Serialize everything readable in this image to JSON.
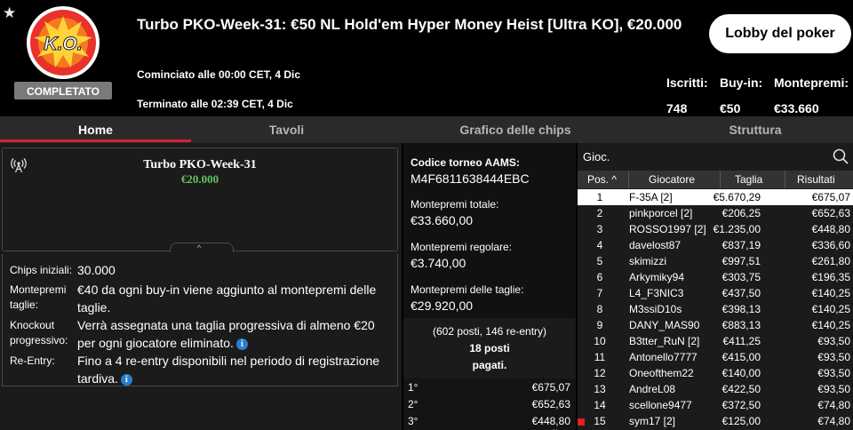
{
  "header": {
    "title": "Turbo PKO-Week-31: €50 NL Hold'em Hyper Money Heist [Ultra KO], €20.000",
    "badge_logo_text": "K.O.",
    "badge_status": "COMPLETATO",
    "started": "Cominciato alle 00:00 CET, 4 Dic",
    "ended": "Terminato alle 02:39 CET, 4 Dic",
    "lobby_button": "Lobby del poker",
    "stats": [
      {
        "label": "Iscritti:",
        "value": "748"
      },
      {
        "label": "Buy-in:",
        "value": "€50"
      },
      {
        "label": "Montepremi:",
        "value": "€33.660"
      }
    ]
  },
  "tabs": [
    {
      "label": "Home",
      "active": true
    },
    {
      "label": "Tavoli",
      "active": false
    },
    {
      "label": "Grafico delle chips",
      "active": false
    },
    {
      "label": "Struttura",
      "active": false
    }
  ],
  "widget": {
    "title": "Turbo PKO-Week-31",
    "amount": "€20.000",
    "collapse_glyph": "^"
  },
  "info": [
    {
      "label": "Chips iniziali:",
      "value": "30.000",
      "info_icon": false
    },
    {
      "label": "Montepremi taglie:",
      "value": "€40 da ogni buy-in viene aggiunto al montepremi delle taglie.",
      "info_icon": false
    },
    {
      "label": "Knockout progressivo:",
      "value": "Verrà assegnata una taglia progressiva di almeno €20 per ogni giocatore eliminato.",
      "info_icon": true
    },
    {
      "label": "Re-Entry:",
      "value": "Fino a 4 re-entry disponibili nel periodo di registrazione tardiva.",
      "info_icon": true
    }
  ],
  "info_icon_glyph": "i",
  "middle": {
    "aams_label": "Codice torneo AAMS:",
    "aams_code": "M4F6811638444EBC",
    "total_label": "Montepremi totale:",
    "total_value": "€33.660,00",
    "regular_label": "Montepremi regolare:",
    "regular_value": "€3.740,00",
    "bounty_label": "Montepremi delle taglie:",
    "bounty_value": "€29.920,00",
    "places_line1": "(602 posti, 146 re-entry)",
    "places_line2": "18 posti",
    "places_line3": "pagati.",
    "prizes": [
      {
        "pos": "1°",
        "amount": "€675,07"
      },
      {
        "pos": "2°",
        "amount": "€652,63"
      },
      {
        "pos": "3°",
        "amount": "€448,80"
      }
    ]
  },
  "players": {
    "search_label": "Gioc.",
    "columns": {
      "pos": "Pos.",
      "player": "Giocatore",
      "bounty": "Taglia",
      "results": "Risultati"
    },
    "sort_glyph": "^",
    "rows": [
      {
        "pos": "1",
        "name": "F-35A [2]",
        "bounty": "€5.670,29",
        "result": "€675,07",
        "highlighted": true
      },
      {
        "pos": "2",
        "name": "pinkporcel [2]",
        "bounty": "€206,25",
        "result": "€652,63"
      },
      {
        "pos": "3",
        "name": "ROSSO1997 [2]",
        "bounty": "€1.235,00",
        "result": "€448,80"
      },
      {
        "pos": "4",
        "name": "davelost87",
        "bounty": "€837,19",
        "result": "€336,60"
      },
      {
        "pos": "5",
        "name": "skimizzi",
        "bounty": "€997,51",
        "result": "€261,80"
      },
      {
        "pos": "6",
        "name": "Arkymiky94",
        "bounty": "€303,75",
        "result": "€196,35"
      },
      {
        "pos": "7",
        "name": "L4_F3NIC3",
        "bounty": "€437,50",
        "result": "€140,25"
      },
      {
        "pos": "8",
        "name": "M3ssiD10s",
        "bounty": "€398,13",
        "result": "€140,25"
      },
      {
        "pos": "9",
        "name": "DANY_MAS90",
        "bounty": "€883,13",
        "result": "€140,25"
      },
      {
        "pos": "10",
        "name": "B3tter_RuN [2]",
        "bounty": "€411,25",
        "result": "€93,50"
      },
      {
        "pos": "11",
        "name": "Antonello7777",
        "bounty": "€415,00",
        "result": "€93,50"
      },
      {
        "pos": "12",
        "name": "Oneofthem22",
        "bounty": "€140,00",
        "result": "€93,50"
      },
      {
        "pos": "13",
        "name": "AndreL08",
        "bounty": "€422,50",
        "result": "€93,50"
      },
      {
        "pos": "14",
        "name": "scellone9477",
        "bounty": "€372,50",
        "result": "€74,80"
      },
      {
        "pos": "15",
        "name": "sym17 [2]",
        "bounty": "€125,00",
        "result": "€74,80",
        "marker": true
      }
    ]
  },
  "colors": {
    "accent_red": "#d31f36",
    "amount_green": "#5ec45e",
    "info_blue": "#2a7fcf",
    "marker_red": "#e32222"
  }
}
